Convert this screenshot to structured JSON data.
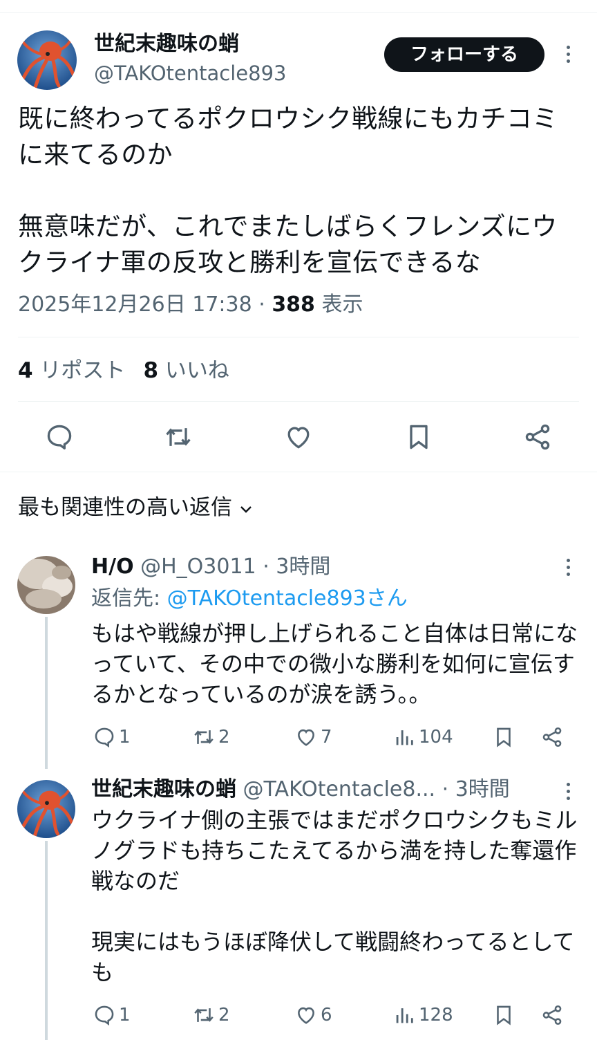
{
  "main_tweet": {
    "name": "世紀末趣味の蛸",
    "handle": "@TAKOtentacle893",
    "follow_label": "フォローする",
    "text": "既に終わってるポクロウシク戦線にもカチコミに来てるのか\n\n無意味だが、これでまたしばらくフレンズにウクライナ軍の反攻と勝利を宣伝できるな",
    "datetime": "2025年12月26日 17:38",
    "views_count": "388",
    "views_label": "表示",
    "reposts_count": "4",
    "reposts_label": "リポスト",
    "likes_count": "8",
    "likes_label": "いいね",
    "actions": [
      "reply-icon",
      "repost-icon",
      "like-icon",
      "bookmark-icon",
      "share-icon"
    ]
  },
  "sort": {
    "label": "最も関連性の高い返信"
  },
  "replies": [
    {
      "name": "H/O",
      "handle": "@H_O3011",
      "time": "· 3時間",
      "replying_prefix": "返信先: ",
      "replying_to": "@TAKOtentacle893さん",
      "text": "もはや戦線が押し上げられること自体は日常になっていて、その中での微小な勝利を如何に宣伝するかとなっているのが涙を誘う。。",
      "replies": "1",
      "reposts": "2",
      "likes": "7",
      "views": "104"
    },
    {
      "name": "世紀末趣味の蛸",
      "handle": "@TAKOtentacle8...",
      "time": "· 3時間",
      "text": "ウクライナ側の主張ではまだポクロウシクもミルノグラドも持ちこたえてるから満を持した奪還作戦なのだ\n\n現実にはもうほぼ降伏して戦闘終わってるとしても",
      "replies": "1",
      "reposts": "2",
      "likes": "6",
      "views": "128"
    }
  ],
  "colors": {
    "text": "#0f1419",
    "secondary": "#536471",
    "link": "#1d9bf0",
    "divider": "#eff3f4",
    "octopus": "#e0522f",
    "avatar_bg": "#2f5f9e"
  }
}
